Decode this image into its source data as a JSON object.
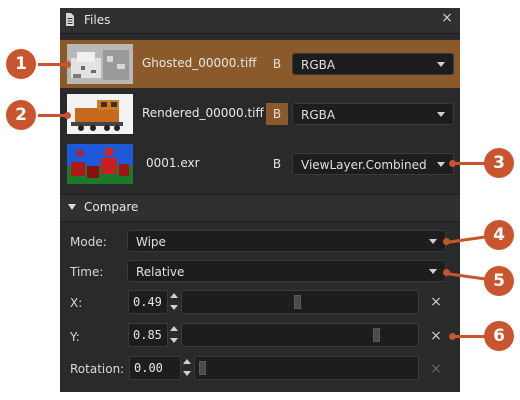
{
  "panel": {
    "title": "Files",
    "close_glyph": "×"
  },
  "files": [
    {
      "name": "Ghosted_00000.tiff",
      "b_label": "B",
      "b_active": false,
      "channel": "RGBA",
      "selected": true,
      "thumb": "noise-icon"
    },
    {
      "name": "Rendered_00000.tiff",
      "b_label": "B",
      "b_active": true,
      "channel": "RGBA",
      "selected": false,
      "thumb": "locomotive-icon"
    },
    {
      "name": "0001.exr",
      "b_label": "B",
      "b_active": false,
      "channel": "ViewLayer.Combined",
      "selected": false,
      "thumb": "cubes-icon"
    }
  ],
  "compare": {
    "section_title": "Compare",
    "mode_label": "Mode:",
    "mode_value": "Wipe",
    "time_label": "Time:",
    "time_value": "Relative",
    "x_label": "X:",
    "x_value": "0.49",
    "y_label": "Y:",
    "y_value": "0.85",
    "rotation_label": "Rotation:",
    "rotation_value": "0.00",
    "reset_glyph": "×"
  },
  "callouts": [
    "1",
    "2",
    "3",
    "4",
    "5",
    "6"
  ],
  "colors": {
    "accent": "#8a5a2a",
    "callout": "#c8552e",
    "panel_bg": "#2a2a2a",
    "field_bg": "#1d1d1d"
  }
}
